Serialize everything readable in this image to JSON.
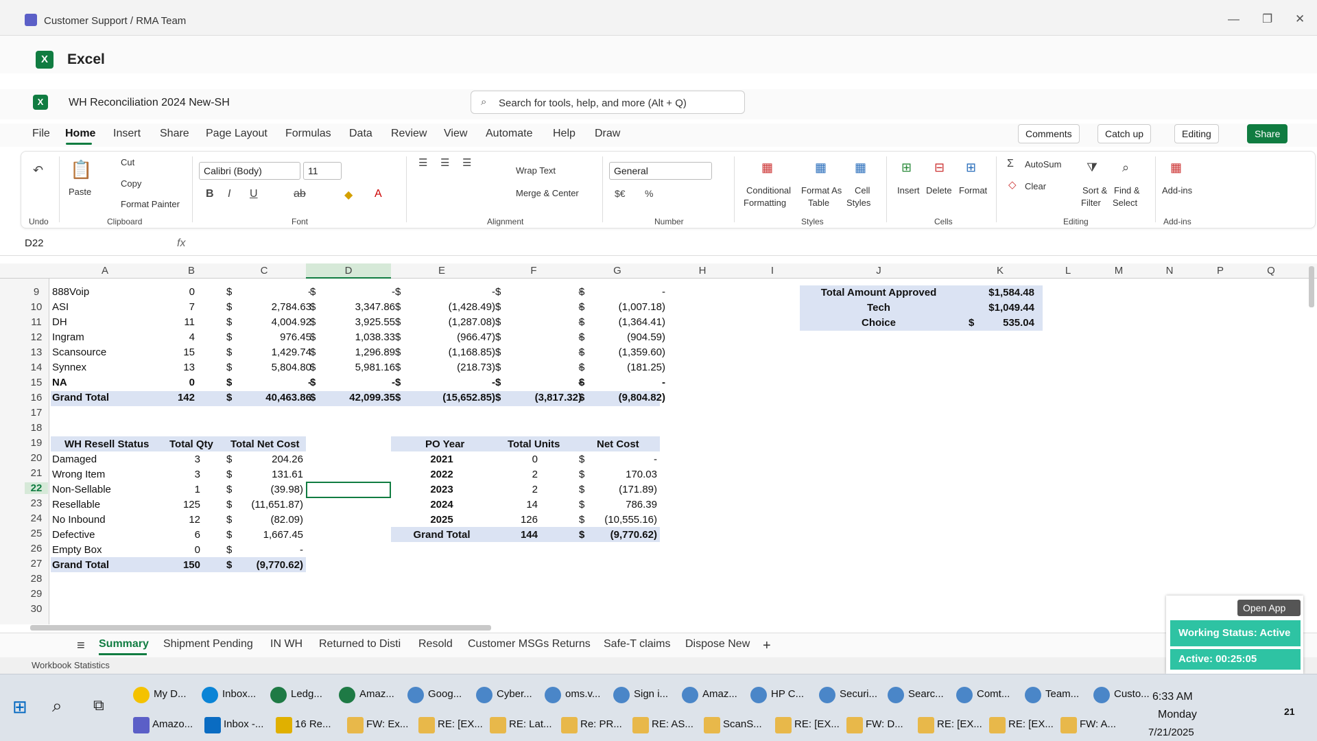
{
  "window": {
    "title": "Customer Support / RMA Team"
  },
  "app": {
    "name": "Excel",
    "doc_name": "WH Reconciliation 2024 New-SH",
    "search_placeholder": "Search for tools, help, and more (Alt + Q)"
  },
  "menu": [
    "File",
    "Home",
    "Insert",
    "Share",
    "Page Layout",
    "Formulas",
    "Data",
    "Review",
    "View",
    "Automate",
    "Help",
    "Draw"
  ],
  "top_buttons": {
    "comments": "Comments",
    "catchup": "Catch up",
    "editing": "Editing",
    "share": "Share"
  },
  "ribbon": {
    "undo": "Undo",
    "clipboard": {
      "paste": "Paste",
      "cut": "Cut",
      "copy": "Copy",
      "format_painter": "Format Painter",
      "group": "Clipboard"
    },
    "font": {
      "name": "Calibri (Body)",
      "size": "11",
      "group": "Font"
    },
    "alignment": {
      "wrap": "Wrap Text",
      "merge": "Merge & Center",
      "group": "Alignment"
    },
    "number": {
      "format": "General",
      "group": "Number"
    },
    "styles": {
      "cond1": "Conditional",
      "cond2": "Formatting",
      "fmt1": "Format As",
      "fmt2": "Table",
      "cell1": "Cell",
      "cell2": "Styles",
      "group": "Styles"
    },
    "cells": {
      "insert": "Insert",
      "delete": "Delete",
      "format": "Format",
      "group": "Cells"
    },
    "editing": {
      "autosum": "AutoSum",
      "clear": "Clear",
      "sort1": "Sort &",
      "sort2": "Filter",
      "find1": "Find &",
      "find2": "Select",
      "group": "Editing"
    },
    "addins": {
      "label": "Add-ins",
      "group": "Add-ins"
    }
  },
  "formula_bar": {
    "name_box": "D22",
    "fx": "fx"
  },
  "columns": [
    "A",
    "B",
    "C",
    "D",
    "E",
    "F",
    "G",
    "H",
    "I",
    "J",
    "K",
    "L",
    "M",
    "N",
    "P",
    "Q"
  ],
  "rows": [
    "9",
    "10",
    "11",
    "12",
    "13",
    "14",
    "15",
    "16",
    "17",
    "18",
    "19",
    "20",
    "21",
    "22",
    "23",
    "24",
    "25",
    "26",
    "27",
    "28",
    "29",
    "30"
  ],
  "vendor_table": [
    {
      "a": "888Voip",
      "b": "0",
      "c": "-",
      "d": "-",
      "e": "-",
      "f": "-",
      "g": "-"
    },
    {
      "a": "ASI",
      "b": "7",
      "c": "2,784.63",
      "d": "3,347.86",
      "e": "(1,428.49)",
      "f": "-",
      "g": "(1,007.18)"
    },
    {
      "a": "DH",
      "b": "11",
      "c": "4,004.92",
      "d": "3,925.55",
      "e": "(1,287.08)",
      "f": "-",
      "g": "(1,364.41)"
    },
    {
      "a": "Ingram",
      "b": "4",
      "c": "976.45",
      "d": "1,038.33",
      "e": "(966.47)",
      "f": "-",
      "g": "(904.59)"
    },
    {
      "a": "Scansource",
      "b": "15",
      "c": "1,429.74",
      "d": "1,296.89",
      "e": "(1,168.85)",
      "f": "-",
      "g": "(1,359.60)"
    },
    {
      "a": "Synnex",
      "b": "13",
      "c": "5,804.80",
      "d": "5,981.16",
      "e": "(218.73)",
      "f": "-",
      "g": "(181.25)"
    },
    {
      "a": "NA",
      "b": "0",
      "c": "-",
      "d": "-",
      "e": "-",
      "f": "-",
      "g": "-"
    },
    {
      "a": "Grand Total",
      "b": "142",
      "c": "40,463.86",
      "d": "42,099.35",
      "e": "(15,652.85)",
      "f": "(3,817.32)",
      "g": "(9,804.82)"
    }
  ],
  "resell": {
    "headers": [
      "WH Resell Status",
      "Total Qty",
      "Total Net Cost"
    ],
    "rows": [
      {
        "s": "Damaged",
        "q": "3",
        "c": "204.26"
      },
      {
        "s": "Wrong Item",
        "q": "3",
        "c": "131.61"
      },
      {
        "s": "Non-Sellable",
        "q": "1",
        "c": "(39.98)"
      },
      {
        "s": "Resellable",
        "q": "125",
        "c": "(11,651.87)"
      },
      {
        "s": "No Inbound",
        "q": "12",
        "c": "(82.09)"
      },
      {
        "s": "Defective",
        "q": "6",
        "c": "1,667.45"
      },
      {
        "s": "Empty Box",
        "q": "0",
        "c": "-"
      },
      {
        "s": "Grand Total",
        "q": "150",
        "c": "(9,770.62)"
      }
    ]
  },
  "po": {
    "headers": [
      "PO Year",
      "Total Units",
      "Net Cost"
    ],
    "rows": [
      {
        "y": "2021",
        "u": "0",
        "c": "-"
      },
      {
        "y": "2022",
        "u": "2",
        "c": "170.03"
      },
      {
        "y": "2023",
        "u": "2",
        "c": "(171.89)"
      },
      {
        "y": "2024",
        "u": "14",
        "c": "786.39"
      },
      {
        "y": "2025",
        "u": "126",
        "c": "(10,555.16)"
      },
      {
        "y": "Grand Total",
        "u": "144",
        "c": "(9,770.62)"
      }
    ]
  },
  "approved": [
    {
      "label": "Total Amount Approved",
      "value": "$1,584.48"
    },
    {
      "label": "Tech",
      "value": "$1,049.44"
    },
    {
      "label": "Choice",
      "value": "535.04"
    }
  ],
  "currency": "$",
  "sheets": [
    "Summary",
    "Shipment Pending",
    "IN WH",
    "Returned to Disti",
    "Resold",
    "Customer MSGs Returns",
    "Safe-T claims",
    "Dispose New"
  ],
  "status": {
    "left": "Workbook Statistics"
  },
  "panel": {
    "open_app": "Open App",
    "working": "Working Status: Active",
    "active": "Active: 00:25:05"
  },
  "taskbar_row1": [
    "My D...",
    "Inbox...",
    "Ledg...",
    "Amaz...",
    "Goog...",
    "Cyber...",
    "oms.v...",
    "Sign i...",
    "Amaz...",
    "HP C...",
    "Securi...",
    "Searc...",
    "Comt...",
    "Team...",
    "Custo..."
  ],
  "taskbar_row2": [
    "Amazo...",
    "Inbox -...",
    "16 Re...",
    "FW: Ex...",
    "RE: [EX...",
    "RE: Lat...",
    "Re: PR...",
    "RE: AS...",
    "ScanS...",
    "RE: [EX...",
    "FW: D...",
    "RE: [EX...",
    "RE: [EX...",
    "FW: A..."
  ],
  "clock": {
    "time": "6:33 AM",
    "day": "Monday",
    "date": "7/21/2025",
    "notif": "21"
  },
  "colors": {
    "accent": "#107c41",
    "band": "#dbe3f3",
    "teal": "#2ec3a3"
  }
}
